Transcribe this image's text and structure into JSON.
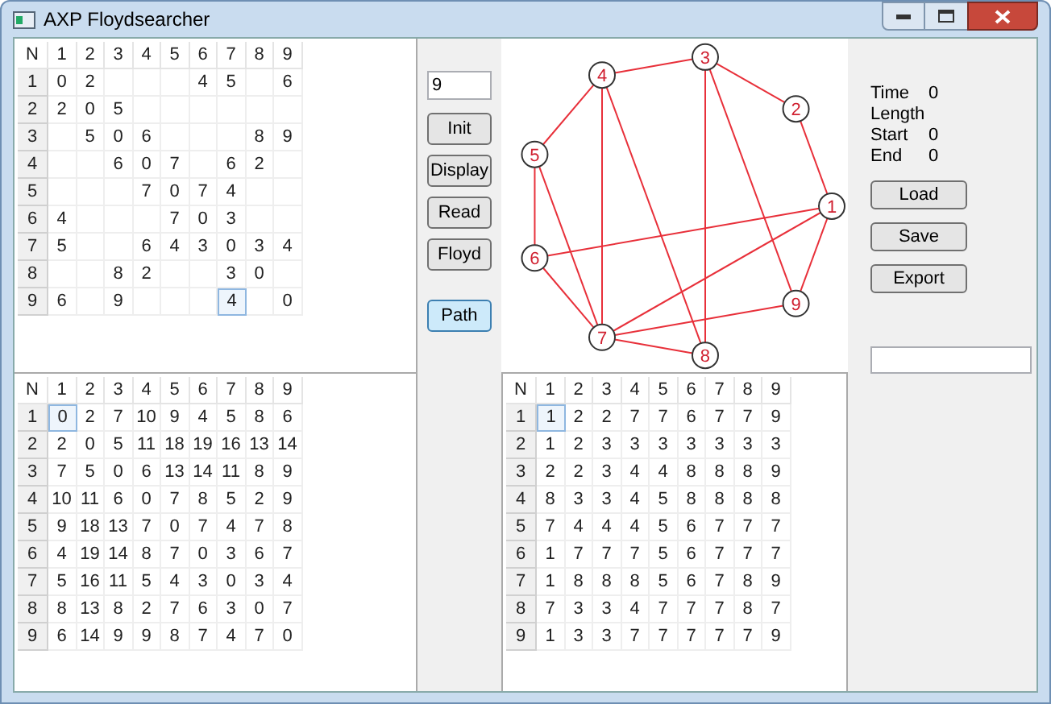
{
  "window": {
    "title": "AXP Floydsearcher"
  },
  "adjacency_grid": {
    "corner": "N",
    "columns": [
      "1",
      "2",
      "3",
      "4",
      "5",
      "6",
      "7",
      "8",
      "9"
    ],
    "rows": [
      {
        "header": "1",
        "cells": [
          {
            "text": "0",
            "selected": false
          },
          {
            "text": "2",
            "selected": false
          },
          {
            "text": "",
            "selected": false
          },
          {
            "text": "",
            "selected": false
          },
          {
            "text": "",
            "selected": false
          },
          {
            "text": "4",
            "selected": false
          },
          {
            "text": "5",
            "selected": false
          },
          {
            "text": "",
            "selected": false
          },
          {
            "text": "6",
            "selected": false
          }
        ]
      },
      {
        "header": "2",
        "cells": [
          {
            "text": "2",
            "selected": false
          },
          {
            "text": "0",
            "selected": false
          },
          {
            "text": "5",
            "selected": false
          },
          {
            "text": "",
            "selected": false
          },
          {
            "text": "",
            "selected": false
          },
          {
            "text": "",
            "selected": false
          },
          {
            "text": "",
            "selected": false
          },
          {
            "text": "",
            "selected": false
          },
          {
            "text": "",
            "selected": false
          }
        ]
      },
      {
        "header": "3",
        "cells": [
          {
            "text": "",
            "selected": false
          },
          {
            "text": "5",
            "selected": false
          },
          {
            "text": "0",
            "selected": false
          },
          {
            "text": "6",
            "selected": false
          },
          {
            "text": "",
            "selected": false
          },
          {
            "text": "",
            "selected": false
          },
          {
            "text": "",
            "selected": false
          },
          {
            "text": "8",
            "selected": false
          },
          {
            "text": "9",
            "selected": false
          }
        ]
      },
      {
        "header": "4",
        "cells": [
          {
            "text": "",
            "selected": false
          },
          {
            "text": "",
            "selected": false
          },
          {
            "text": "6",
            "selected": false
          },
          {
            "text": "0",
            "selected": false
          },
          {
            "text": "7",
            "selected": false
          },
          {
            "text": "",
            "selected": false
          },
          {
            "text": "6",
            "selected": false
          },
          {
            "text": "2",
            "selected": false
          },
          {
            "text": "",
            "selected": false
          }
        ]
      },
      {
        "header": "5",
        "cells": [
          {
            "text": "",
            "selected": false
          },
          {
            "text": "",
            "selected": false
          },
          {
            "text": "",
            "selected": false
          },
          {
            "text": "7",
            "selected": false
          },
          {
            "text": "0",
            "selected": false
          },
          {
            "text": "7",
            "selected": false
          },
          {
            "text": "4",
            "selected": false
          },
          {
            "text": "",
            "selected": false
          },
          {
            "text": "",
            "selected": false
          }
        ]
      },
      {
        "header": "6",
        "cells": [
          {
            "text": "4",
            "selected": false
          },
          {
            "text": "",
            "selected": false
          },
          {
            "text": "",
            "selected": false
          },
          {
            "text": "",
            "selected": false
          },
          {
            "text": "7",
            "selected": false
          },
          {
            "text": "0",
            "selected": false
          },
          {
            "text": "3",
            "selected": false
          },
          {
            "text": "",
            "selected": false
          },
          {
            "text": "",
            "selected": false
          }
        ]
      },
      {
        "header": "7",
        "cells": [
          {
            "text": "5",
            "selected": false
          },
          {
            "text": "",
            "selected": false
          },
          {
            "text": "",
            "selected": false
          },
          {
            "text": "6",
            "selected": false
          },
          {
            "text": "4",
            "selected": false
          },
          {
            "text": "3",
            "selected": false
          },
          {
            "text": "0",
            "selected": false
          },
          {
            "text": "3",
            "selected": false
          },
          {
            "text": "4",
            "selected": false
          }
        ]
      },
      {
        "header": "8",
        "cells": [
          {
            "text": "",
            "selected": false
          },
          {
            "text": "",
            "selected": false
          },
          {
            "text": "8",
            "selected": false
          },
          {
            "text": "2",
            "selected": false
          },
          {
            "text": "",
            "selected": false
          },
          {
            "text": "",
            "selected": false
          },
          {
            "text": "3",
            "selected": false
          },
          {
            "text": "0",
            "selected": false
          },
          {
            "text": "",
            "selected": false
          }
        ]
      },
      {
        "header": "9",
        "cells": [
          {
            "text": "6",
            "selected": false
          },
          {
            "text": "",
            "selected": false
          },
          {
            "text": "9",
            "selected": false
          },
          {
            "text": "",
            "selected": false
          },
          {
            "text": "",
            "selected": false
          },
          {
            "text": "",
            "selected": false
          },
          {
            "text": "4",
            "selected": true
          },
          {
            "text": "",
            "selected": false
          },
          {
            "text": "0",
            "selected": false
          }
        ]
      }
    ]
  },
  "distance_grid": {
    "corner": "N",
    "columns": [
      "1",
      "2",
      "3",
      "4",
      "5",
      "6",
      "7",
      "8",
      "9"
    ],
    "rows": [
      {
        "header": "1",
        "cells": [
          {
            "text": "0",
            "selected": true
          },
          {
            "text": "2",
            "selected": false
          },
          {
            "text": "7",
            "selected": false
          },
          {
            "text": "10",
            "selected": false
          },
          {
            "text": "9",
            "selected": false
          },
          {
            "text": "4",
            "selected": false
          },
          {
            "text": "5",
            "selected": false
          },
          {
            "text": "8",
            "selected": false
          },
          {
            "text": "6",
            "selected": false
          }
        ]
      },
      {
        "header": "2",
        "cells": [
          {
            "text": "2",
            "selected": false
          },
          {
            "text": "0",
            "selected": false
          },
          {
            "text": "5",
            "selected": false
          },
          {
            "text": "11",
            "selected": false
          },
          {
            "text": "18",
            "selected": false
          },
          {
            "text": "19",
            "selected": false
          },
          {
            "text": "16",
            "selected": false
          },
          {
            "text": "13",
            "selected": false
          },
          {
            "text": "14",
            "selected": false
          }
        ]
      },
      {
        "header": "3",
        "cells": [
          {
            "text": "7",
            "selected": false
          },
          {
            "text": "5",
            "selected": false
          },
          {
            "text": "0",
            "selected": false
          },
          {
            "text": "6",
            "selected": false
          },
          {
            "text": "13",
            "selected": false
          },
          {
            "text": "14",
            "selected": false
          },
          {
            "text": "11",
            "selected": false
          },
          {
            "text": "8",
            "selected": false
          },
          {
            "text": "9",
            "selected": false
          }
        ]
      },
      {
        "header": "4",
        "cells": [
          {
            "text": "10",
            "selected": false
          },
          {
            "text": "11",
            "selected": false
          },
          {
            "text": "6",
            "selected": false
          },
          {
            "text": "0",
            "selected": false
          },
          {
            "text": "7",
            "selected": false
          },
          {
            "text": "8",
            "selected": false
          },
          {
            "text": "5",
            "selected": false
          },
          {
            "text": "2",
            "selected": false
          },
          {
            "text": "9",
            "selected": false
          }
        ]
      },
      {
        "header": "5",
        "cells": [
          {
            "text": "9",
            "selected": false
          },
          {
            "text": "18",
            "selected": false
          },
          {
            "text": "13",
            "selected": false
          },
          {
            "text": "7",
            "selected": false
          },
          {
            "text": "0",
            "selected": false
          },
          {
            "text": "7",
            "selected": false
          },
          {
            "text": "4",
            "selected": false
          },
          {
            "text": "7",
            "selected": false
          },
          {
            "text": "8",
            "selected": false
          }
        ]
      },
      {
        "header": "6",
        "cells": [
          {
            "text": "4",
            "selected": false
          },
          {
            "text": "19",
            "selected": false
          },
          {
            "text": "14",
            "selected": false
          },
          {
            "text": "8",
            "selected": false
          },
          {
            "text": "7",
            "selected": false
          },
          {
            "text": "0",
            "selected": false
          },
          {
            "text": "3",
            "selected": false
          },
          {
            "text": "6",
            "selected": false
          },
          {
            "text": "7",
            "selected": false
          }
        ]
      },
      {
        "header": "7",
        "cells": [
          {
            "text": "5",
            "selected": false
          },
          {
            "text": "16",
            "selected": false
          },
          {
            "text": "11",
            "selected": false
          },
          {
            "text": "5",
            "selected": false
          },
          {
            "text": "4",
            "selected": false
          },
          {
            "text": "3",
            "selected": false
          },
          {
            "text": "0",
            "selected": false
          },
          {
            "text": "3",
            "selected": false
          },
          {
            "text": "4",
            "selected": false
          }
        ]
      },
      {
        "header": "8",
        "cells": [
          {
            "text": "8",
            "selected": false
          },
          {
            "text": "13",
            "selected": false
          },
          {
            "text": "8",
            "selected": false
          },
          {
            "text": "2",
            "selected": false
          },
          {
            "text": "7",
            "selected": false
          },
          {
            "text": "6",
            "selected": false
          },
          {
            "text": "3",
            "selected": false
          },
          {
            "text": "0",
            "selected": false
          },
          {
            "text": "7",
            "selected": false
          }
        ]
      },
      {
        "header": "9",
        "cells": [
          {
            "text": "6",
            "selected": false
          },
          {
            "text": "14",
            "selected": false
          },
          {
            "text": "9",
            "selected": false
          },
          {
            "text": "9",
            "selected": false
          },
          {
            "text": "8",
            "selected": false
          },
          {
            "text": "7",
            "selected": false
          },
          {
            "text": "4",
            "selected": false
          },
          {
            "text": "7",
            "selected": false
          },
          {
            "text": "0",
            "selected": false
          }
        ]
      }
    ]
  },
  "path_grid": {
    "corner": "N",
    "columns": [
      "1",
      "2",
      "3",
      "4",
      "5",
      "6",
      "7",
      "8",
      "9"
    ],
    "rows": [
      {
        "header": "1",
        "cells": [
          {
            "text": "1",
            "selected": true
          },
          {
            "text": "2",
            "selected": false
          },
          {
            "text": "2",
            "selected": false
          },
          {
            "text": "7",
            "selected": false
          },
          {
            "text": "7",
            "selected": false
          },
          {
            "text": "6",
            "selected": false
          },
          {
            "text": "7",
            "selected": false
          },
          {
            "text": "7",
            "selected": false
          },
          {
            "text": "9",
            "selected": false
          }
        ]
      },
      {
        "header": "2",
        "cells": [
          {
            "text": "1",
            "selected": false
          },
          {
            "text": "2",
            "selected": false
          },
          {
            "text": "3",
            "selected": false
          },
          {
            "text": "3",
            "selected": false
          },
          {
            "text": "3",
            "selected": false
          },
          {
            "text": "3",
            "selected": false
          },
          {
            "text": "3",
            "selected": false
          },
          {
            "text": "3",
            "selected": false
          },
          {
            "text": "3",
            "selected": false
          }
        ]
      },
      {
        "header": "3",
        "cells": [
          {
            "text": "2",
            "selected": false
          },
          {
            "text": "2",
            "selected": false
          },
          {
            "text": "3",
            "selected": false
          },
          {
            "text": "4",
            "selected": false
          },
          {
            "text": "4",
            "selected": false
          },
          {
            "text": "8",
            "selected": false
          },
          {
            "text": "8",
            "selected": false
          },
          {
            "text": "8",
            "selected": false
          },
          {
            "text": "9",
            "selected": false
          }
        ]
      },
      {
        "header": "4",
        "cells": [
          {
            "text": "8",
            "selected": false
          },
          {
            "text": "3",
            "selected": false
          },
          {
            "text": "3",
            "selected": false
          },
          {
            "text": "4",
            "selected": false
          },
          {
            "text": "5",
            "selected": false
          },
          {
            "text": "8",
            "selected": false
          },
          {
            "text": "8",
            "selected": false
          },
          {
            "text": "8",
            "selected": false
          },
          {
            "text": "8",
            "selected": false
          }
        ]
      },
      {
        "header": "5",
        "cells": [
          {
            "text": "7",
            "selected": false
          },
          {
            "text": "4",
            "selected": false
          },
          {
            "text": "4",
            "selected": false
          },
          {
            "text": "4",
            "selected": false
          },
          {
            "text": "5",
            "selected": false
          },
          {
            "text": "6",
            "selected": false
          },
          {
            "text": "7",
            "selected": false
          },
          {
            "text": "7",
            "selected": false
          },
          {
            "text": "7",
            "selected": false
          }
        ]
      },
      {
        "header": "6",
        "cells": [
          {
            "text": "1",
            "selected": false
          },
          {
            "text": "7",
            "selected": false
          },
          {
            "text": "7",
            "selected": false
          },
          {
            "text": "7",
            "selected": false
          },
          {
            "text": "5",
            "selected": false
          },
          {
            "text": "6",
            "selected": false
          },
          {
            "text": "7",
            "selected": false
          },
          {
            "text": "7",
            "selected": false
          },
          {
            "text": "7",
            "selected": false
          }
        ]
      },
      {
        "header": "7",
        "cells": [
          {
            "text": "1",
            "selected": false
          },
          {
            "text": "8",
            "selected": false
          },
          {
            "text": "8",
            "selected": false
          },
          {
            "text": "8",
            "selected": false
          },
          {
            "text": "5",
            "selected": false
          },
          {
            "text": "6",
            "selected": false
          },
          {
            "text": "7",
            "selected": false
          },
          {
            "text": "8",
            "selected": false
          },
          {
            "text": "9",
            "selected": false
          }
        ]
      },
      {
        "header": "8",
        "cells": [
          {
            "text": "7",
            "selected": false
          },
          {
            "text": "3",
            "selected": false
          },
          {
            "text": "3",
            "selected": false
          },
          {
            "text": "4",
            "selected": false
          },
          {
            "text": "7",
            "selected": false
          },
          {
            "text": "7",
            "selected": false
          },
          {
            "text": "7",
            "selected": false
          },
          {
            "text": "8",
            "selected": false
          },
          {
            "text": "7",
            "selected": false
          }
        ]
      },
      {
        "header": "9",
        "cells": [
          {
            "text": "1",
            "selected": false
          },
          {
            "text": "3",
            "selected": false
          },
          {
            "text": "3",
            "selected": false
          },
          {
            "text": "7",
            "selected": false
          },
          {
            "text": "7",
            "selected": false
          },
          {
            "text": "7",
            "selected": false
          },
          {
            "text": "7",
            "selected": false
          },
          {
            "text": "7",
            "selected": false
          },
          {
            "text": "9",
            "selected": false
          }
        ]
      }
    ]
  },
  "controls": {
    "node_count": "9",
    "buttons": [
      {
        "label": "Init",
        "focused": false
      },
      {
        "label": "Display",
        "focused": false
      },
      {
        "label": "Read",
        "focused": false
      },
      {
        "label": "Floyd",
        "focused": false
      },
      {
        "label": "Path",
        "focused": true
      }
    ]
  },
  "graph": {
    "nodes": [
      "1",
      "2",
      "3",
      "4",
      "5",
      "6",
      "7",
      "8",
      "9"
    ]
  },
  "info": [
    {
      "label": "Time",
      "value": "0"
    },
    {
      "label": "Length"
    },
    {
      "label": "Start",
      "value": "0"
    },
    {
      "label": "End",
      "value": "0"
    }
  ],
  "file_buttons": [
    "Load",
    "Save",
    "Export"
  ]
}
